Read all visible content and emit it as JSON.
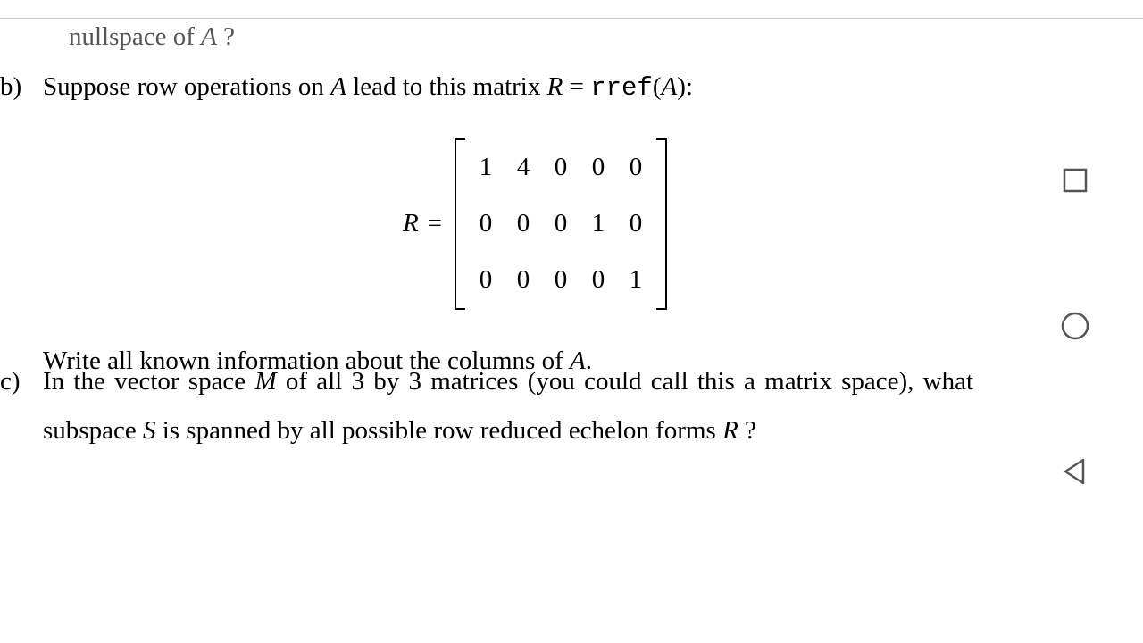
{
  "fragment_top": {
    "text1": "nullspace of ",
    "var": "A",
    "text2": " ?"
  },
  "part_b": {
    "label": "b)",
    "line1_pre": "Suppose row operations on ",
    "line1_var1": "A",
    "line1_mid": " lead to this matrix ",
    "line1_var2": "R",
    "line1_eq": " = ",
    "line1_fn": "rref",
    "line1_arg_open": "(",
    "line1_arg": "A",
    "line1_arg_close": "):",
    "matrix": {
      "lhs": "R",
      "eq": "=",
      "rows": [
        [
          "1",
          "4",
          "0",
          "0",
          "0"
        ],
        [
          "0",
          "0",
          "0",
          "1",
          "0"
        ],
        [
          "0",
          "0",
          "0",
          "0",
          "1"
        ]
      ]
    },
    "line2_pre": "Write all known information about the columns of ",
    "line2_var": "A",
    "line2_post": "."
  },
  "part_c": {
    "label": "c)",
    "seg1": "In the vector space ",
    "var_M": "M",
    "seg2": " of all 3 by 3 matrices (you could call this a matrix space), what subspace ",
    "var_S": "S",
    "seg3": " is spanned by all possible row reduced echelon forms ",
    "var_R": "R",
    "seg4": " ?"
  },
  "nav": {
    "recent": "recent-apps",
    "home": "home",
    "back": "back"
  }
}
